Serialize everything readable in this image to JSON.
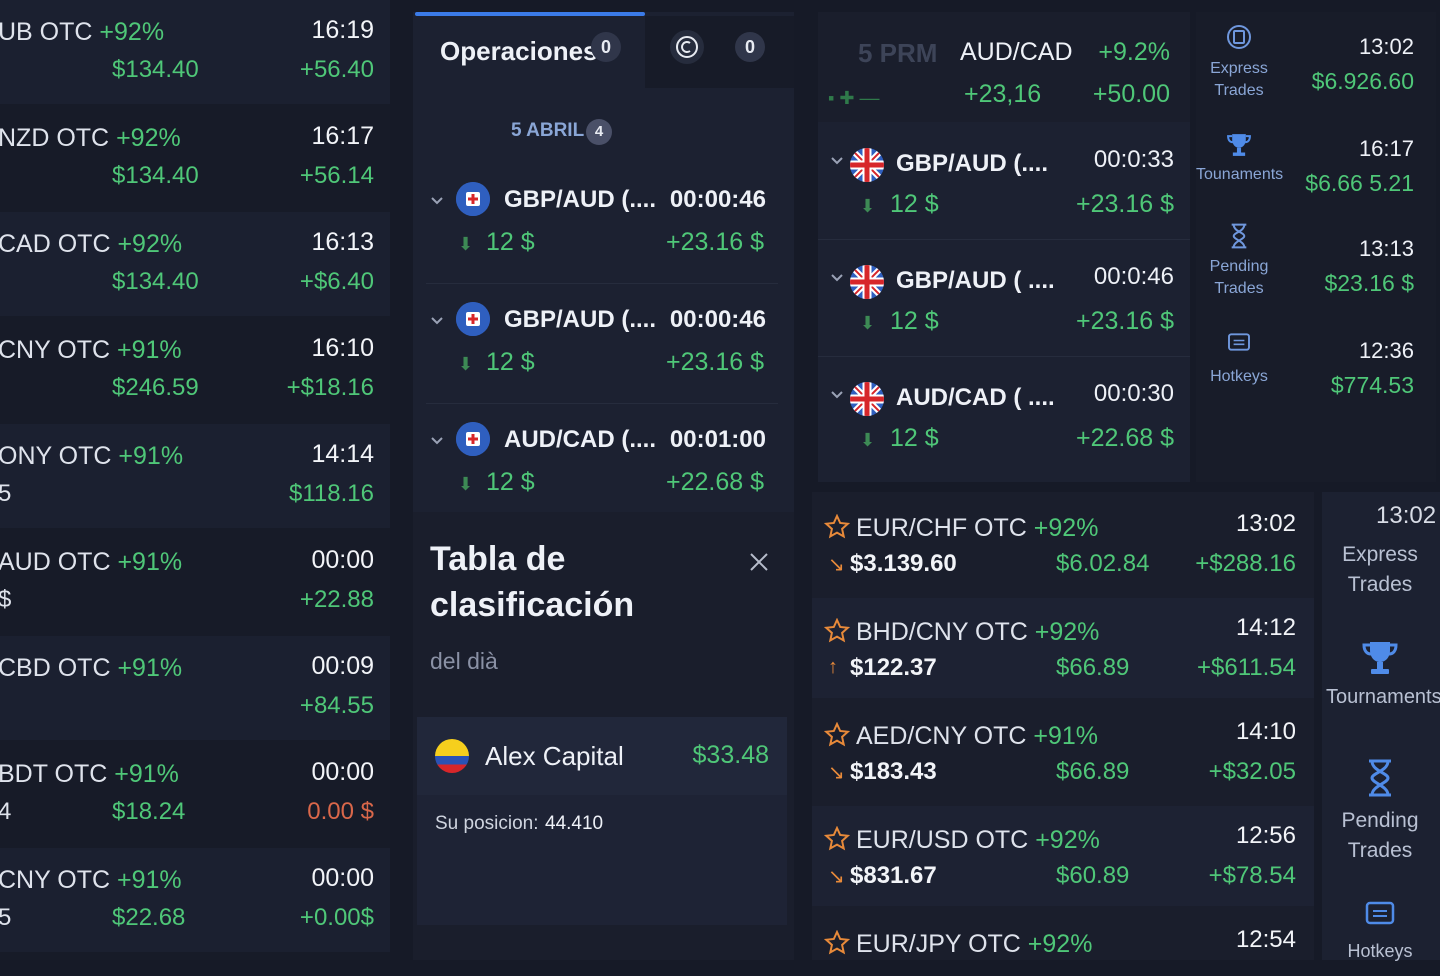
{
  "left_list": [
    {
      "pair": "UB OTC",
      "pct": "+92%",
      "time": "16:19",
      "v1": "$134.40",
      "v2": "+56.40",
      "v1_left": false,
      "v2_red": false
    },
    {
      "pair": "NZD OTC",
      "pct": "+92%",
      "time": "16:17",
      "v1": "$134.40",
      "v2": "+56.14",
      "v1_left": false,
      "v2_red": false
    },
    {
      "pair": "CAD OTC",
      "pct": "+92%",
      "time": "16:13",
      "v1": "$134.40",
      "v2": "+$6.40",
      "v1_left": false,
      "v2_red": false
    },
    {
      "pair": "CNY OTC",
      "pct": "+91%",
      "time": "16:10",
      "v1": "$246.59",
      "v2": "+$18.16",
      "v1_left": false,
      "v2_red": false
    },
    {
      "pair": "ONY OTC",
      "pct": "+91%",
      "time": "14:14",
      "v1": "5",
      "v2": "$118.16",
      "v1_left": true,
      "v2_red": false
    },
    {
      "pair": "AUD OTC",
      "pct": "+91%",
      "time": "00:00",
      "v1": "$",
      "v2": "+22.88",
      "v1_left": true,
      "v2_red": false
    },
    {
      "pair": "CBD OTC",
      "pct": "+91%",
      "time": "00:09",
      "v1": "",
      "v2": "+84.55",
      "v1_left": false,
      "v2_red": false
    },
    {
      "pair": "BDT OTC",
      "pct": "+91%",
      "time": "00:00",
      "v1": "$18.24",
      "v2": "0.00 $",
      "v1_left": false,
      "v2_red": true,
      "v0": "4"
    },
    {
      "pair": "CNY OTC",
      "pct": "+91%",
      "time": "00:00",
      "v1": "$22.68",
      "v2": "+0.00$",
      "v1_left": false,
      "v2_red": false,
      "v0": "5"
    }
  ],
  "operations": {
    "tab_label": "Operaciones",
    "tab_count": "0",
    "clock_count": "0",
    "date_label": "5 ABRIL",
    "date_count": "4",
    "items": [
      {
        "name": "GBP/AUD (....",
        "time": "00:00:46",
        "amount": "12 $",
        "payout": "+23.16 $"
      },
      {
        "name": "GBP/AUD (....",
        "time": "00:00:46",
        "amount": "12 $",
        "payout": "+23.16 $"
      },
      {
        "name": "AUD/CAD (....",
        "time": "00:01:00",
        "amount": "12 $",
        "payout": "+22.68 $"
      }
    ]
  },
  "leaderboard": {
    "title_line1": "Tabla de",
    "title_line2": "clasificación",
    "subtitle": "del dià",
    "user_name": "Alex Capital",
    "user_amount": "$33.48",
    "position_label": "Su posicion:",
    "position_value": "44.410"
  },
  "top_right": {
    "logo_text": "5 PRM",
    "pair": "AUD/CAD",
    "pct": "+9.2%",
    "mid": "+23,16",
    "payout": "+50.00",
    "items": [
      {
        "name": "GBP/AUD (....",
        "time": "00:0:33",
        "amount": "12 $",
        "payout": "+23.16 $"
      },
      {
        "name": "GBP/AUD ( ....",
        "time": "00:0:46",
        "amount": "12 $",
        "payout": "+23.16 $"
      },
      {
        "name": "AUD/CAD ( ....",
        "time": "00:0:30",
        "amount": "12 $",
        "payout": "+22.68 $"
      }
    ]
  },
  "side_nav_small": [
    {
      "label1": "Express",
      "label2": "Trades",
      "icon": "express-trades-icon"
    },
    {
      "label1": "Tounaments",
      "label2": "",
      "icon": "trophy-icon"
    },
    {
      "label1": "Pending",
      "label2": "Trades",
      "icon": "hourglass-icon"
    },
    {
      "label1": "Hotkeys",
      "label2": "",
      "icon": "keyboard-icon"
    }
  ],
  "side_values": [
    {
      "time": "13:02",
      "value": "$6.926.60"
    },
    {
      "time": "16:17",
      "value": "$6.66 5.21"
    },
    {
      "time": "13:13",
      "value": "$23.16 $"
    },
    {
      "time": "12:36",
      "value": "$774.53"
    }
  ],
  "assets": [
    {
      "pair": "EUR/CHF OTC",
      "pct": "+92%",
      "time": "13:02",
      "dir": "down",
      "price": "$3.139.60",
      "mid": "$6.02.84",
      "change": "+$288.16"
    },
    {
      "pair": "BHD/CNY OTC",
      "pct": "+92%",
      "time": "14:12",
      "dir": "up",
      "price": "$122.37",
      "mid": "$66.89",
      "change": "+$611.54"
    },
    {
      "pair": "AED/CNY OTC",
      "pct": "+91%",
      "time": "14:10",
      "dir": "down",
      "price": "$183.43",
      "mid": "$66.89",
      "change": "+$32.05"
    },
    {
      "pair": "EUR/USD OTC",
      "pct": "+92%",
      "time": "12:56",
      "dir": "down",
      "price": "$831.67",
      "mid": "$60.89",
      "change": "+$78.54"
    },
    {
      "pair": "EUR/JPY OTC",
      "pct": "+92%",
      "time": "12:54",
      "dir": "down",
      "price": "",
      "mid": "",
      "change": ""
    }
  ],
  "bottom_nav": {
    "time": "13:02",
    "express1": "Express",
    "express2": "Trades",
    "tournaments": "Tournaments",
    "pending1": "Pending",
    "pending2": "Trades",
    "hotkeys": "Hotkeys"
  },
  "colors": {
    "green": "#4fc778",
    "red": "#d9674a",
    "accent": "#3b7be8",
    "panel": "#1c2131"
  }
}
